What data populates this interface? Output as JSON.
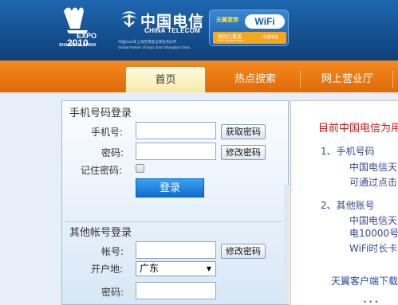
{
  "header": {
    "expo_logo_text": "EXPO 2010",
    "expo_caption": "SHANGHAI CHINA",
    "brand_name": "中国电信",
    "brand_en": "CHINA TELECOM",
    "partner_line1": "中国2010年上海世博会全球合作伙伴",
    "partner_line2": "Global Partner of Expo 2010 Shanghai China",
    "wifi_brand": "天翼宽带",
    "wifi_text": "WiFi",
    "wifi_area": "网络已覆盖",
    "wifi_area_en": "WiFi Service Area",
    "wifi_mini": "中国电信"
  },
  "nav": {
    "items": [
      "首页",
      "热点搜索",
      "网上营业厅"
    ]
  },
  "phone_login": {
    "title": "手机号码登录",
    "phone_label": "手机号:",
    "get_password_button": "获取密码",
    "password_label": "密码:",
    "change_password_button": "修改密码",
    "remember_label": "记住密码:",
    "login_button": "登录"
  },
  "other_login": {
    "title": "其他帐号登录",
    "account_label": "帐号:",
    "change_password_button": "修改密码",
    "region_label": "开户地:",
    "region_selected": "广东",
    "password_label": "密码:"
  },
  "right_panel": {
    "title": "目前中国电信为用",
    "item1_head": "1、手机号码",
    "item1_line1": "中国电信天",
    "item1_line2": "可通过点击",
    "item2_head": "2、其他账号",
    "item2_line1": "中国电信天",
    "item2_line2": "电10000号查",
    "item2_line3": "WiFi时长卡",
    "client_download": "天翼客户端下载"
  },
  "colors": {
    "header_blue": "#1a5ca3",
    "nav_orange": "#ee7d14",
    "login_button_blue": "#1d7ad8",
    "alert_red": "#c61a1a"
  }
}
